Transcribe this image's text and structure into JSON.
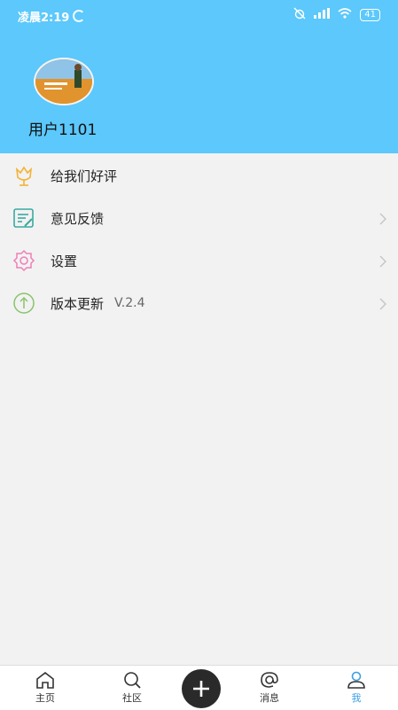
{
  "status_bar": {
    "time": "凌晨2:19",
    "battery": "41"
  },
  "profile": {
    "username": "用户1101"
  },
  "menu": [
    {
      "label": "给我们好评",
      "icon": "flower-icon",
      "color": "#f3b336"
    },
    {
      "label": "意见反馈",
      "icon": "feedback-icon",
      "color": "#3aa9a0"
    },
    {
      "label": "设置",
      "icon": "gear-icon",
      "color": "#ee7fb6"
    },
    {
      "label": "版本更新",
      "version": "V.2.4",
      "icon": "upgrade-icon",
      "color": "#8ac36b"
    }
  ],
  "tabs": [
    {
      "label": "主页",
      "icon": "home-icon"
    },
    {
      "label": "社区",
      "icon": "search-icon"
    },
    {
      "label": "消息",
      "icon": "at-icon"
    },
    {
      "label": "我",
      "icon": "user-icon",
      "active": true
    }
  ],
  "accent_color": "#5cc8fb"
}
